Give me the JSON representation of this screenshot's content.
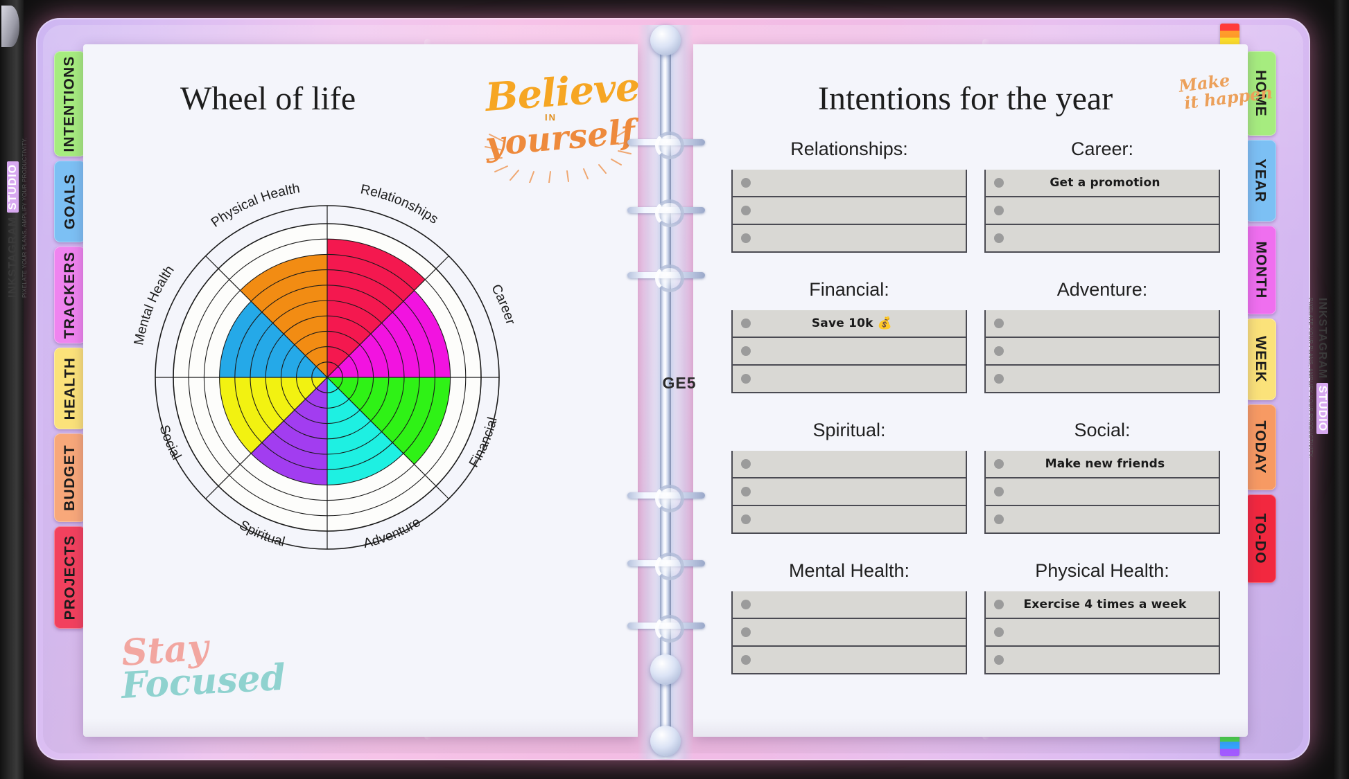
{
  "planner": {
    "spine_label": "GE5",
    "left_page": {
      "title": "Wheel of life",
      "script_believe_line1": "Believe",
      "script_believe_in": "IN",
      "script_believe_line2": "yourself",
      "script_stay": "Stay",
      "script_focused": "Focused"
    },
    "right_page": {
      "title": "Intentions for the year",
      "script_make": "Make",
      "script_happen": "it happen"
    }
  },
  "left_tabs": [
    {
      "label": "INTENTIONS",
      "color": "#a6ec7f"
    },
    {
      "label": "GOALS",
      "color": "#7cc0f4"
    },
    {
      "label": "TRACKERS",
      "color": "#ef84ef"
    },
    {
      "label": "HEALTH",
      "color": "#fbe27a"
    },
    {
      "label": "BUDGET",
      "color": "#f8a87a"
    },
    {
      "label": "PROJECTS",
      "color": "#f2415e"
    }
  ],
  "right_tabs": [
    {
      "label": "HOME",
      "color": "#a6ec7f"
    },
    {
      "label": "YEAR",
      "color": "#7cc0f4"
    },
    {
      "label": "MONTH",
      "color": "#ef6fef"
    },
    {
      "label": "WEEK",
      "color": "#fbe27a"
    },
    {
      "label": "TODAY",
      "color": "#f79a63"
    },
    {
      "label": "TO-DO",
      "color": "#f2283f"
    }
  ],
  "watermark": {
    "brand_part1": "INKSTAGRAM",
    "brand_part2": "STUDIO",
    "tagline": "PIXELATE YOUR PLANS, AMPLIFY YOUR PRODUCTIVITY."
  },
  "chart_data": {
    "type": "pie",
    "title": "Wheel of life",
    "rings": 10,
    "scale_max": 10,
    "categories": [
      "Relationships",
      "Career",
      "Financial",
      "Adventure",
      "Spiritual",
      "Social",
      "Mental Health",
      "Physical Health"
    ],
    "values": [
      9,
      8,
      8,
      7,
      7,
      7,
      7,
      8
    ],
    "colors": [
      "#f4184f",
      "#f213e0",
      "#2ff216",
      "#1ef0e2",
      "#a23df0",
      "#f2f211",
      "#25a9e8",
      "#f28c13"
    ],
    "segments": [
      {
        "label": "Relationships",
        "value": 9,
        "color": "#f4184f",
        "start_deg": 0,
        "end_deg": 45
      },
      {
        "label": "Career",
        "value": 8,
        "color": "#f213e0",
        "start_deg": 45,
        "end_deg": 90
      },
      {
        "label": "Financial",
        "value": 8,
        "color": "#2ff216",
        "start_deg": 90,
        "end_deg": 135
      },
      {
        "label": "Adventure",
        "value": 7,
        "color": "#1ef0e2",
        "start_deg": 135,
        "end_deg": 180
      },
      {
        "label": "Spiritual",
        "value": 7,
        "color": "#a23df0",
        "start_deg": 180,
        "end_deg": 225
      },
      {
        "label": "Social",
        "value": 7,
        "color": "#f2f211",
        "start_deg": 225,
        "end_deg": 270
      },
      {
        "label": "Mental Health",
        "value": 7,
        "color": "#25a9e8",
        "start_deg": 270,
        "end_deg": 315
      },
      {
        "label": "Physical Health",
        "value": 8,
        "color": "#f28c13",
        "start_deg": 315,
        "end_deg": 360
      }
    ],
    "grid": true,
    "legend": "none"
  },
  "intentions": [
    {
      "heading": "Relationships:",
      "entries": [
        "",
        "",
        ""
      ]
    },
    {
      "heading": "Career:",
      "entries": [
        "Get a promotion",
        "",
        ""
      ]
    },
    {
      "heading": "Financial:",
      "entries": [
        "Save 10k 💰",
        "",
        ""
      ]
    },
    {
      "heading": "Adventure:",
      "entries": [
        "",
        "",
        ""
      ]
    },
    {
      "heading": "Spiritual:",
      "entries": [
        "",
        "",
        ""
      ]
    },
    {
      "heading": "Social:",
      "entries": [
        "Make new friends",
        "",
        ""
      ]
    },
    {
      "heading": "Mental Health:",
      "entries": [
        "",
        "",
        ""
      ]
    },
    {
      "heading": "Physical Health:",
      "entries": [
        "Exercise 4 times a week",
        "",
        ""
      ]
    }
  ]
}
